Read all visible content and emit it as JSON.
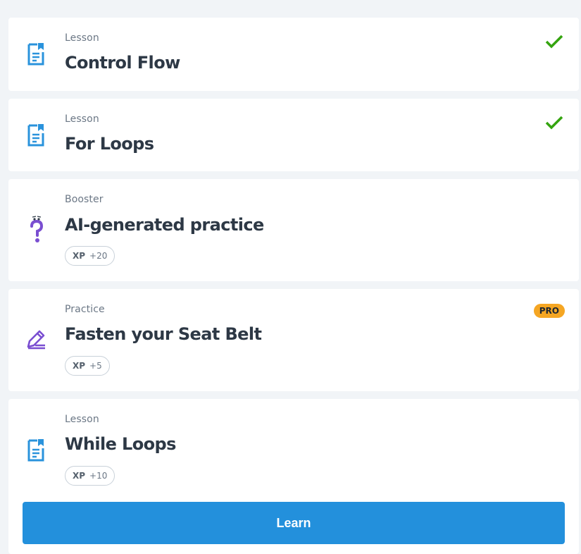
{
  "items": [
    {
      "category": "Lesson",
      "title": "Control Flow",
      "icon": "lesson-document-icon",
      "completed": true
    },
    {
      "category": "Lesson",
      "title": "For Loops",
      "icon": "lesson-document-icon",
      "completed": true
    },
    {
      "category": "Booster",
      "title": "AI-generated practice",
      "icon": "question-mark-character-icon",
      "xp_label": "XP",
      "xp_value": "+20"
    },
    {
      "category": "Practice",
      "title": "Fasten your Seat Belt",
      "icon": "pencil-icon",
      "badge": "PRO",
      "xp_label": "XP",
      "xp_value": "+5"
    },
    {
      "category": "Lesson",
      "title": "While Loops",
      "icon": "lesson-document-icon",
      "xp_label": "XP",
      "xp_value": "+10",
      "action_label": "Learn"
    }
  ],
  "colors": {
    "lesson_icon": "#2a93dc",
    "purple_icon": "#7a4ed1",
    "check": "#34a40f",
    "pro_badge": "#f5a623",
    "learn_button": "#2390dc"
  }
}
